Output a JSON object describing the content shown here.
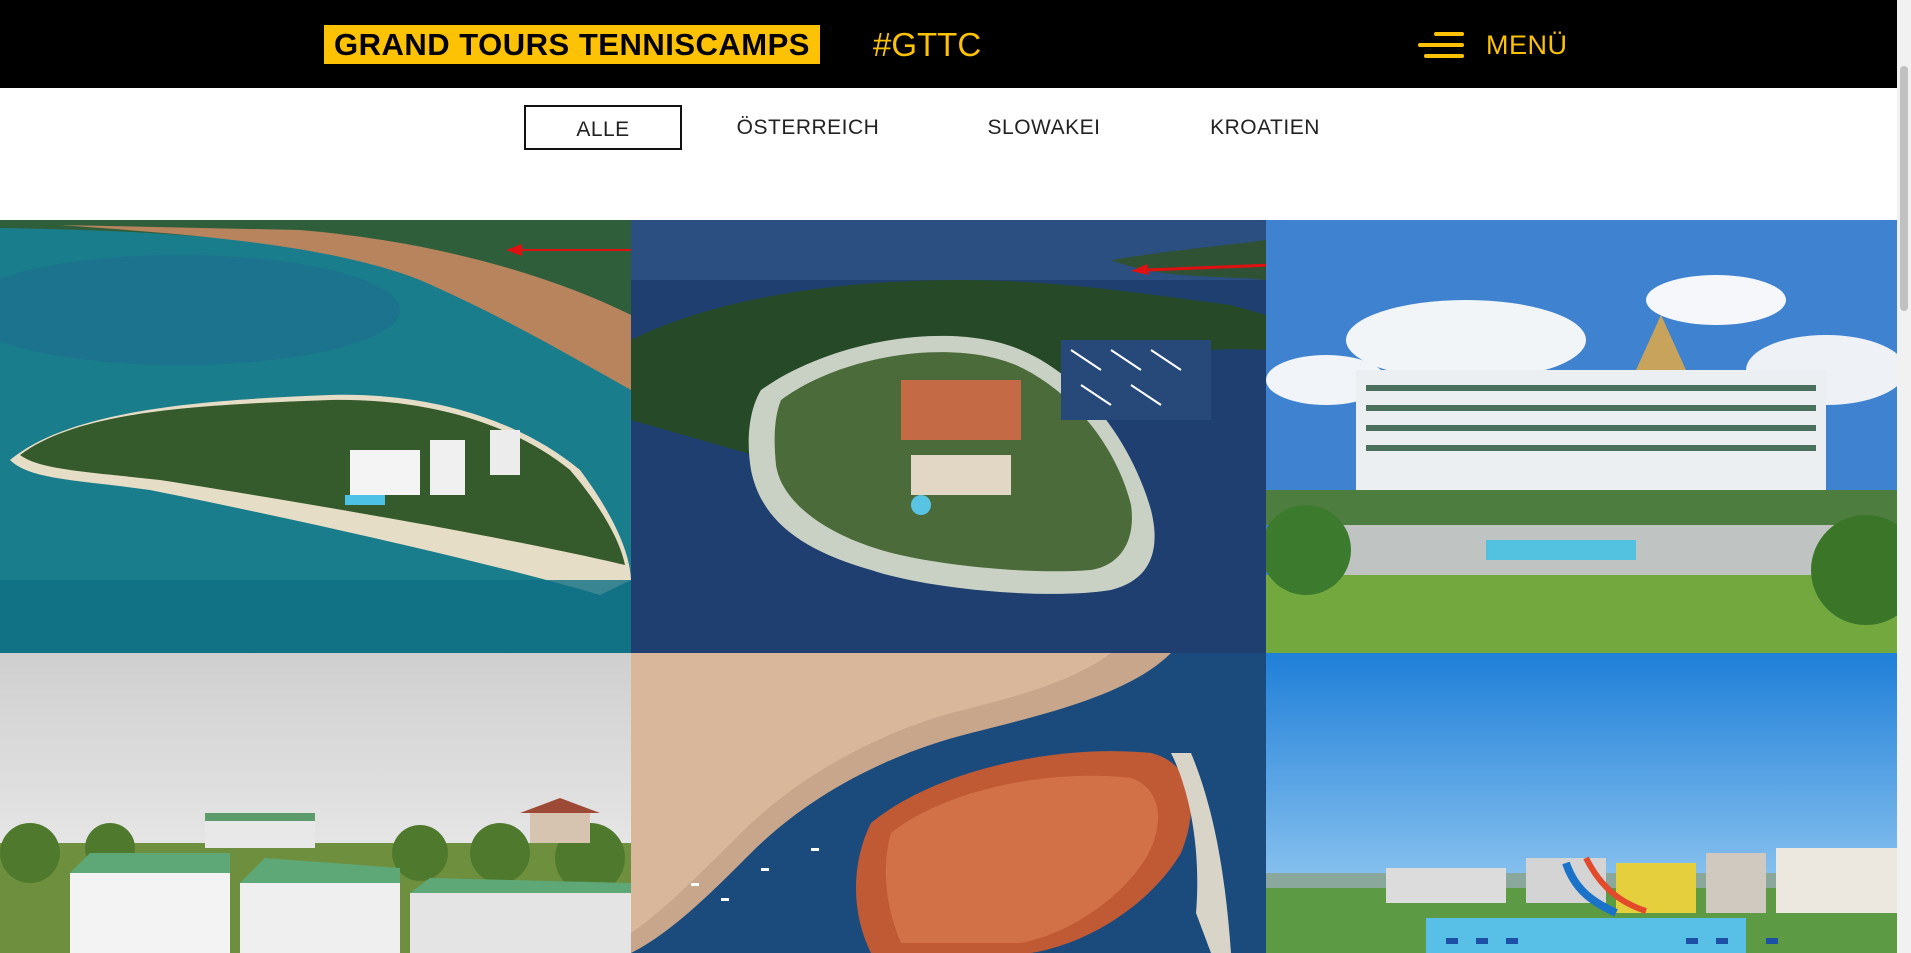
{
  "header": {
    "brand": "GRAND TOURS TENNISCAMPS",
    "hashtag": "#GTTC",
    "menu_label": "MENÜ"
  },
  "filters": {
    "tabs": [
      "ALLE",
      "ÖSTERREICH",
      "SLOWAKEI",
      "KROATIEN"
    ],
    "active": "ALLE"
  },
  "colors": {
    "brand_yellow": "#fdc204",
    "header_bg": "#000000",
    "arrow_red": "#e01010"
  },
  "icons": {
    "menu": "hamburger-menu-icon"
  },
  "gallery": {
    "images": [
      "aerial-island-hotel-coast",
      "aerial-peninsula-resort-marina",
      "hotel-pool-garden-sky",
      "countryside-resort-green-roofs",
      "aerial-old-town-harbour",
      "resort-pool-waterslides"
    ]
  }
}
